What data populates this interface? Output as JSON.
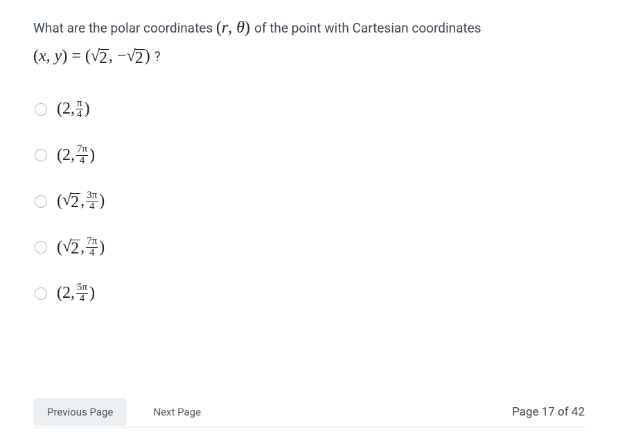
{
  "question": {
    "prefix": "What are the polar coordinates ",
    "rtheta_open": "(",
    "r": "r",
    "comma_rt": ", ",
    "theta": "θ",
    "rtheta_close": ")",
    "mid": " of the point with Cartesian coordinates",
    "xy_open": "(",
    "x": "x",
    "comma_xy": ", ",
    "y": "y",
    "xy_close": ")",
    "eq": " = ",
    "val_open": "(",
    "sqrt2a_sym": "√",
    "sqrt2a_arg": "2",
    "comma_val": ", ",
    "neg": "−",
    "sqrt2b_sym": "√",
    "sqrt2b_arg": "2",
    "val_close": ")",
    "qmark": " ?"
  },
  "options": [
    {
      "open": "(",
      "r": "2",
      "r_sqrt": false,
      "comma": ", ",
      "num": "π",
      "den": "4",
      "close": ")"
    },
    {
      "open": "(",
      "r": "2",
      "r_sqrt": false,
      "comma": ", ",
      "num": "7π",
      "den": "4",
      "close": ")"
    },
    {
      "open": "(",
      "r_sym": "√",
      "r_arg": "2",
      "r_sqrt": true,
      "comma": ", ",
      "num": "3π",
      "den": "4",
      "close": ")"
    },
    {
      "open": "(",
      "r_sym": "√",
      "r_arg": "2",
      "r_sqrt": true,
      "comma": ", ",
      "num": "7π",
      "den": "4",
      "close": ")"
    },
    {
      "open": "(",
      "r": "2",
      "r_sqrt": false,
      "comma": ", ",
      "num": "5π",
      "den": "4",
      "close": ")"
    }
  ],
  "footer": {
    "prev": "Previous Page",
    "next": "Next Page",
    "page": "Page 17 of 42"
  }
}
